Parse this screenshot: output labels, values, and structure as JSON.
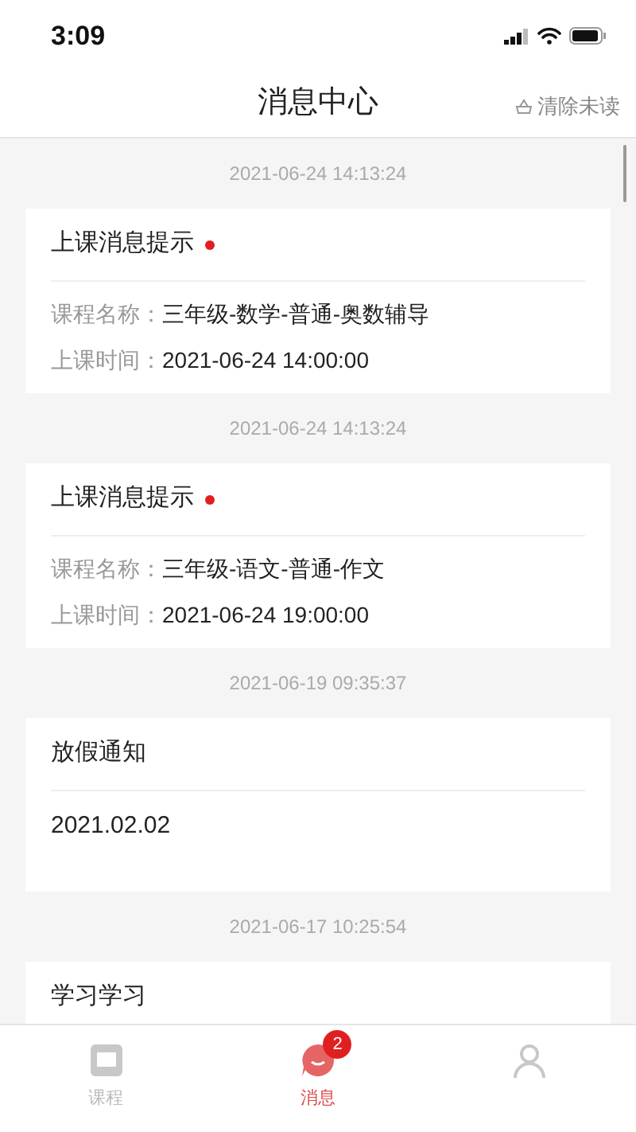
{
  "status_bar": {
    "time": "3:09"
  },
  "header": {
    "title": "消息中心",
    "action": "清除未读"
  },
  "messages": [
    {
      "timestamp": "2021-06-24 14:13:24",
      "kind": "course",
      "title": "上课消息提示",
      "unread": true,
      "fields": [
        {
          "label": "课程名称：",
          "value": "三年级-数学-普通-奥数辅导"
        },
        {
          "label": "上课时间：",
          "value": "2021-06-24 14:00:00"
        }
      ]
    },
    {
      "timestamp": "2021-06-24 14:13:24",
      "kind": "course",
      "title": "上课消息提示",
      "unread": true,
      "fields": [
        {
          "label": "课程名称：",
          "value": "三年级-语文-普通-作文"
        },
        {
          "label": "上课时间：",
          "value": "2021-06-24 19:00:00"
        }
      ]
    },
    {
      "timestamp": "2021-06-19 09:35:37",
      "kind": "notice",
      "title": "放假通知",
      "unread": false,
      "body": "2021.02.02"
    },
    {
      "timestamp": "2021-06-17 10:25:54",
      "kind": "notice",
      "title": "学习学习",
      "unread": false
    }
  ],
  "tab_bar": [
    {
      "kind": "course",
      "label": "课程",
      "selected": false
    },
    {
      "kind": "message",
      "label": "消息",
      "selected": true,
      "badge": "2"
    },
    {
      "kind": "profile",
      "selected": false
    }
  ]
}
